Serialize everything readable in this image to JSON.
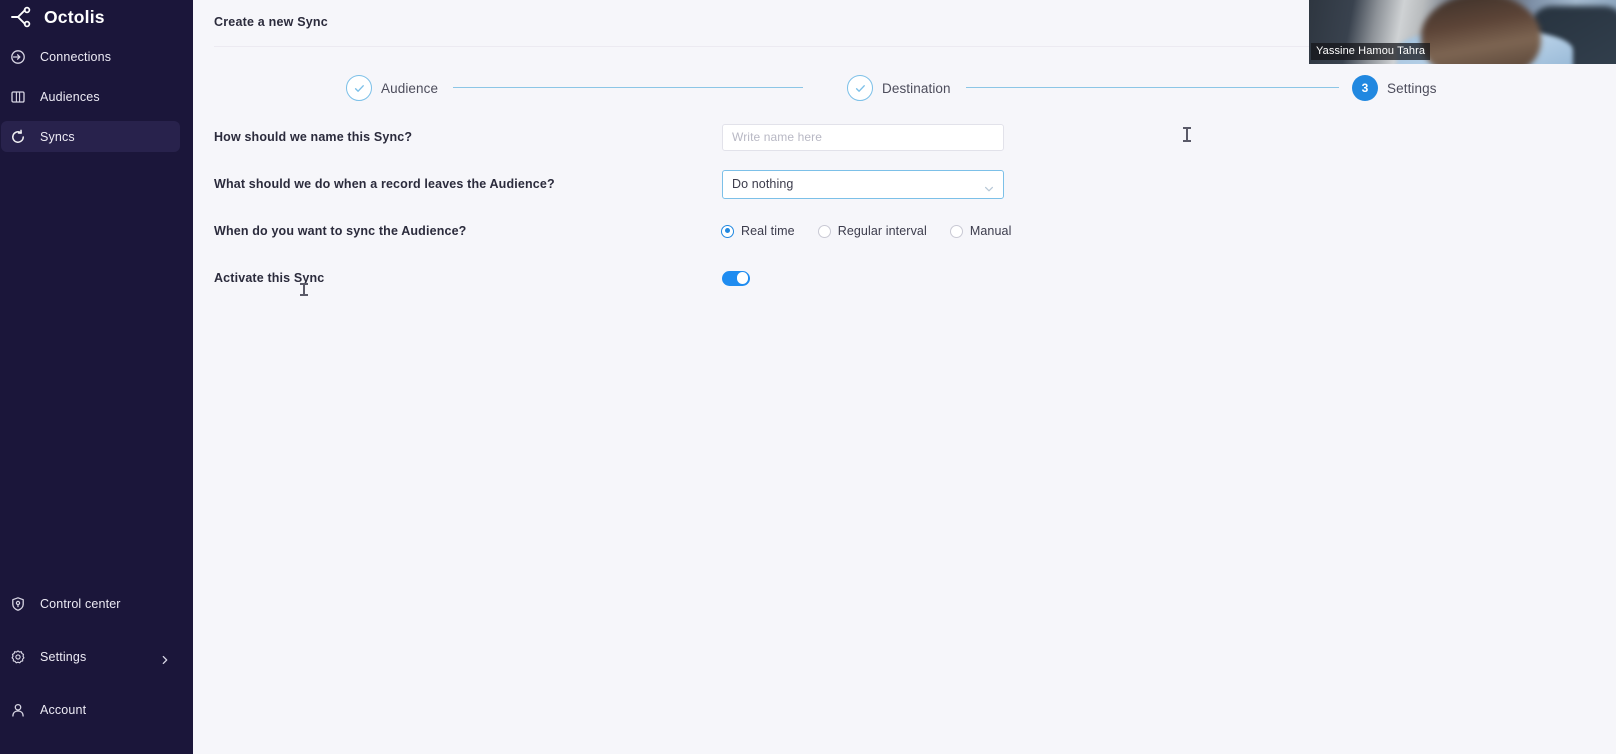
{
  "sidebar": {
    "brand": {
      "name": "Octolis",
      "logo_icon": "octolis-node-logo-icon"
    },
    "items": [
      {
        "label": "Connections",
        "icon": "connections-arrow-icon",
        "active": false
      },
      {
        "label": "Audiences",
        "icon": "audiences-panel-icon",
        "active": false
      },
      {
        "label": "Syncs",
        "icon": "syncs-refresh-icon",
        "active": true
      }
    ],
    "bottom_items": [
      {
        "label": "Control center",
        "icon": "shield-icon",
        "has_chevron": false
      },
      {
        "label": "Settings",
        "icon": "gear-icon",
        "has_chevron": true
      },
      {
        "label": "Account",
        "icon": "person-icon",
        "has_chevron": false
      }
    ]
  },
  "header": {
    "title": "Create a new Sync"
  },
  "stepper": {
    "steps": [
      {
        "label": "Audience",
        "state": "done",
        "marker": "check-icon"
      },
      {
        "label": "Destination",
        "state": "done",
        "marker": "check-icon"
      },
      {
        "label": "Settings",
        "state": "current",
        "marker": "3"
      }
    ]
  },
  "form": {
    "name_row": {
      "label": "How should we name this Sync?",
      "value": "",
      "placeholder": "Write name here"
    },
    "leaves_row": {
      "label": "What should we do when a record leaves the Audience?",
      "selected": "Do nothing",
      "chevron_icon": "chevron-down-icon"
    },
    "schedule_row": {
      "label": "When do you want to sync the Audience?",
      "options": [
        {
          "label": "Real time",
          "selected": true
        },
        {
          "label": "Regular interval",
          "selected": false
        },
        {
          "label": "Manual",
          "selected": false
        }
      ]
    },
    "activate_row": {
      "label": "Activate this Sync",
      "enabled": true
    }
  },
  "webcam": {
    "participant_name": "Yassine Hamou Tahra"
  },
  "colors": {
    "sidebar_bg": "#1b163a",
    "sidebar_active": "#28224c",
    "page_bg": "#f6f6fa",
    "accent_blue": "#2188e0",
    "step_line": "#8cc6e6",
    "toggle_on": "#1f8cf0"
  }
}
